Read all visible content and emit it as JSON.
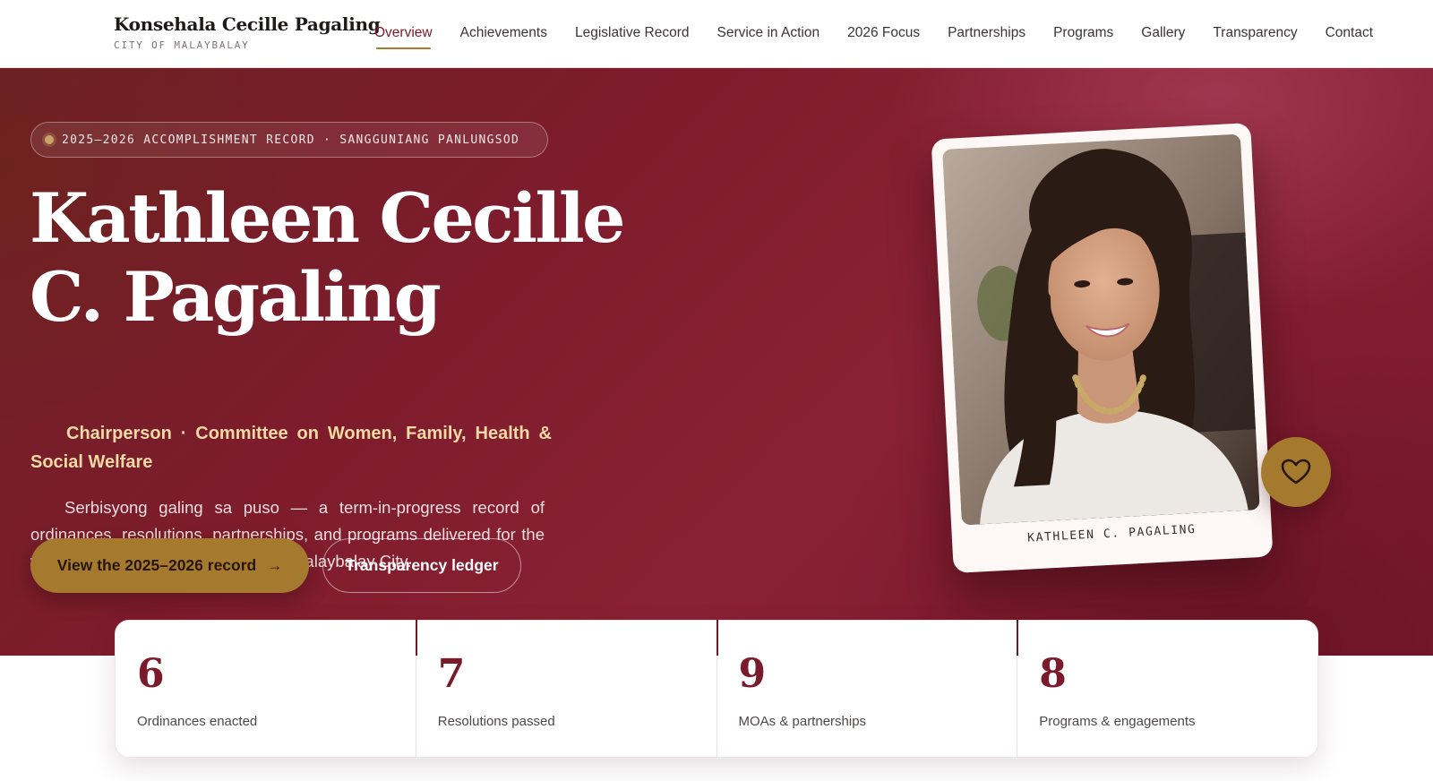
{
  "brand": {
    "name": "Konsehala Cecille Pagaling",
    "subtitle": "CITY OF MALAYBALAY"
  },
  "nav": {
    "items": [
      {
        "label": "Overview",
        "active": true
      },
      {
        "label": "Achievements"
      },
      {
        "label": "Legislative Record"
      },
      {
        "label": "Service in Action"
      },
      {
        "label": "2026 Focus"
      },
      {
        "label": "Partnerships"
      },
      {
        "label": "Programs"
      },
      {
        "label": "Gallery"
      },
      {
        "label": "Transparency"
      },
      {
        "label": "Contact"
      }
    ]
  },
  "hero": {
    "badge": "2025–2026 ACCOMPLISHMENT RECORD · SANGGUNIANG PANLUNGSOD",
    "title_line1": "Kathleen Cecille",
    "title_line2": "C. Pagaling",
    "role": "Chairperson · Committee on Women, Family, Health & Social Welfare",
    "description": "Serbisyong galing sa puso — a term-in-progress record of ordinances, resolutions, partnerships, and programs delivered for the women, families, and barangays of Malaybalay City.",
    "primary_button": "View the 2025–2026 record",
    "primary_button_icon": "arrow-right-icon",
    "secondary_button": "Transparency ledger",
    "portrait_caption": "KATHLEEN C. PAGALING",
    "heart_icon": "heart-icon"
  },
  "stats": [
    {
      "value": "6",
      "label": "Ordinances enacted"
    },
    {
      "value": "7",
      "label": "Resolutions passed"
    },
    {
      "value": "9",
      "label": "MOAs & partnerships"
    },
    {
      "value": "8",
      "label": "Programs & engagements"
    }
  ],
  "colors": {
    "maroon": "#7a1a2a",
    "gold": "#a57a2e",
    "gold_text": "#f3d9a4"
  }
}
